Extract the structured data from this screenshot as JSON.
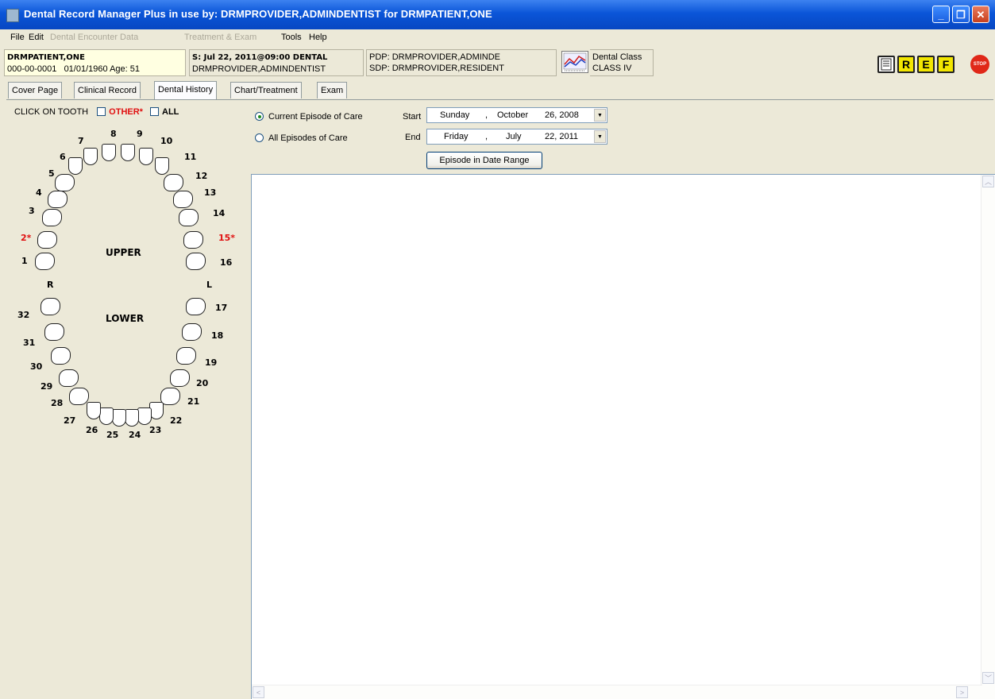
{
  "window": {
    "title": "Dental Record Manager Plus in use by: DRMPROVIDER,ADMINDENTIST for DRMPATIENT,ONE",
    "minimize": "_",
    "restore": "❐",
    "close": "✕"
  },
  "menu": {
    "file": "File",
    "edit": "Edit",
    "encounter": "Dental Encounter Data",
    "treatment": "Treatment & Exam",
    "tools": "Tools",
    "help": "Help"
  },
  "patient": {
    "name": "DRMPATIENT,ONE",
    "ssn": "000-00-0001",
    "dob": "01/01/1960",
    "age_label": "Age:",
    "age": "51",
    "visit": "S: Jul 22, 2011@09:00 DENTAL",
    "visit_provider": "DRMPROVIDER,ADMINDENTIST",
    "pdp": "PDP: DRMPROVIDER,ADMINDE",
    "sdp": "SDP: DRMPROVIDER,RESIDENT",
    "class_label": "Dental Class",
    "class_value": "CLASS IV"
  },
  "toolbar": {
    "r": "R",
    "e": "E",
    "f": "F",
    "stop": "STOP"
  },
  "tabs": [
    "Cover Page",
    "Clinical Record",
    "Dental History",
    "Chart/Treatment",
    "Exam"
  ],
  "active_tab": "Dental History",
  "tooth_chart": {
    "click_label": "CLICK ON TOOTH",
    "other_label": "OTHER*",
    "all_label": "ALL",
    "upper": "UPPER",
    "lower": "LOWER",
    "right": "R",
    "left": "L",
    "numbers": [
      "1",
      "2*",
      "3",
      "4",
      "5",
      "6",
      "7",
      "8",
      "9",
      "10",
      "11",
      "12",
      "13",
      "14",
      "15*",
      "16",
      "17",
      "18",
      "19",
      "20",
      "21",
      "22",
      "23",
      "24",
      "25",
      "26",
      "27",
      "28",
      "29",
      "30",
      "31",
      "32"
    ],
    "highlighted": [
      "2*",
      "15*"
    ]
  },
  "episode": {
    "current": "Current Episode of Care",
    "all": "All Episodes of Care",
    "selected": "current",
    "start_label": "Start",
    "start": {
      "day": "Sunday",
      "month": "October",
      "date": "26, 2008"
    },
    "end_label": "End",
    "end": {
      "day": "Friday",
      "month": "July",
      "date": "22, 2011"
    },
    "sep": ",",
    "button": "Episode in Date Range"
  }
}
